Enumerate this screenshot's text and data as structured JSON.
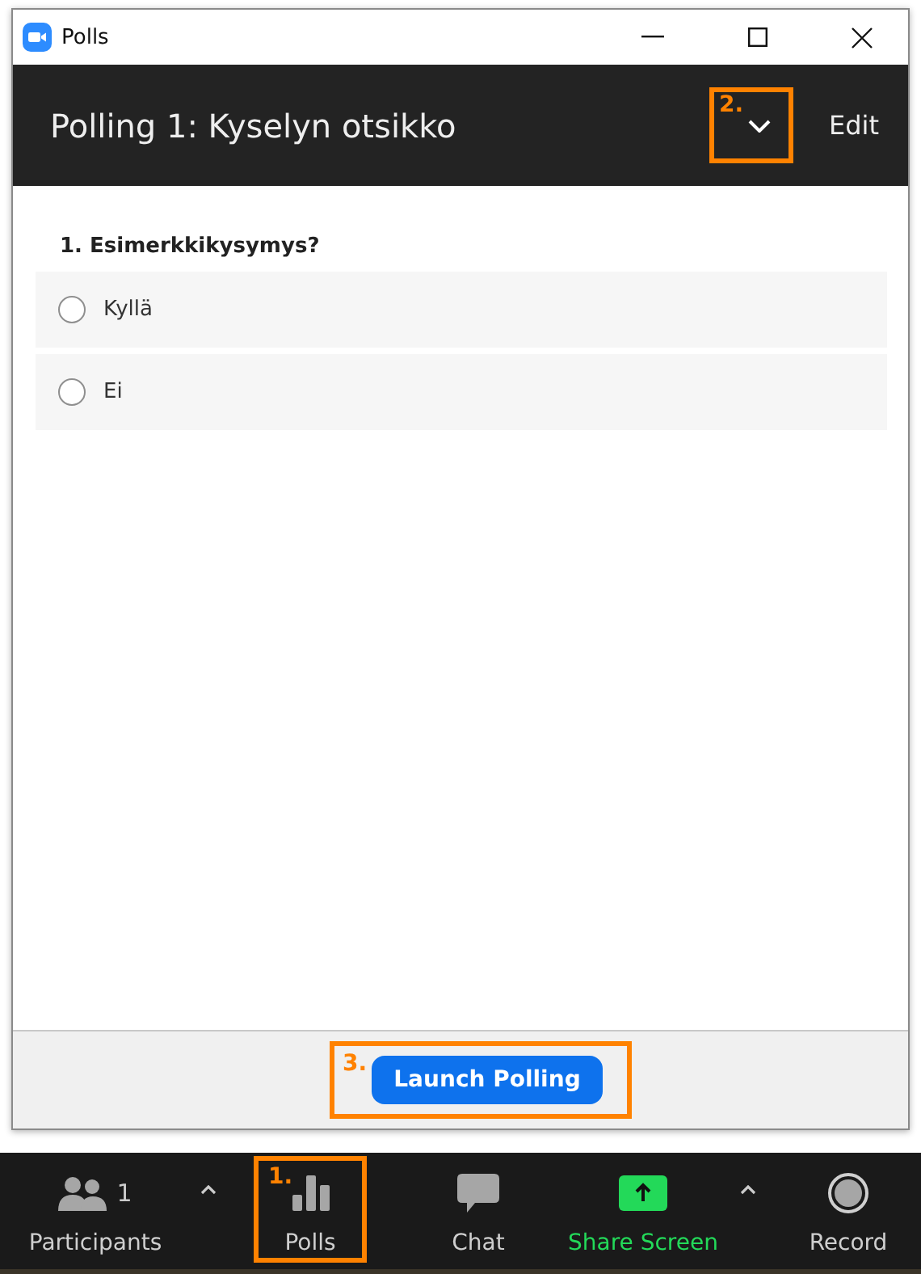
{
  "window": {
    "title": "Polls"
  },
  "header": {
    "title": "Polling 1: Kyselyn otsikko",
    "callout": "2.",
    "edit": "Edit"
  },
  "question": {
    "text": "1. Esimerkkikysymys?",
    "options": [
      {
        "label": "Kyllä",
        "selected": false
      },
      {
        "label": "Ei",
        "selected": false
      }
    ]
  },
  "footer": {
    "button": "Launch Polling",
    "callout": "3."
  },
  "toolbar": [
    {
      "kind": "participants",
      "label": "Participants",
      "count": "1",
      "caret": true
    },
    {
      "kind": "polls",
      "label": "Polls",
      "callout": "1.",
      "caret": false
    },
    {
      "kind": "chat",
      "label": "Chat",
      "caret": false
    },
    {
      "kind": "share",
      "label": "Share Screen",
      "caret": true
    },
    {
      "kind": "record",
      "label": "Record",
      "caret": false
    }
  ]
}
